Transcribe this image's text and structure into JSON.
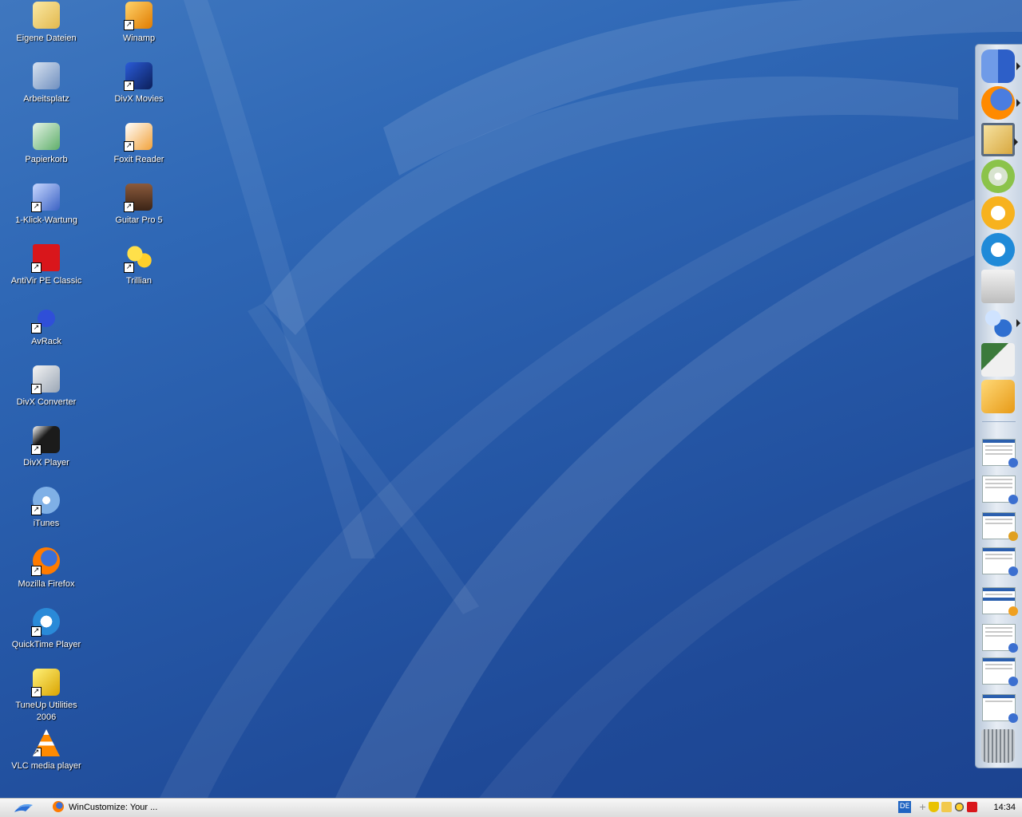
{
  "desktop_icons": {
    "eigene_dateien": "Eigene Dateien",
    "winamp": "Winamp",
    "arbeitsplatz": "Arbeitsplatz",
    "divx_movies": "DivX Movies",
    "papierkorb": "Papierkorb",
    "foxit_reader": "Foxit Reader",
    "klick_wartung": "1-Klick-Wartung",
    "guitar_pro": "Guitar Pro 5",
    "antivir": "AntiVir PE Classic",
    "trillian": "Trillian",
    "avrack": "AvRack",
    "divx_converter": "DivX Converter",
    "divx_player": "DivX Player",
    "itunes": "iTunes",
    "firefox": "Mozilla Firefox",
    "quicktime": "QuickTime Player",
    "tuneup": "TuneUp Utilities 2006",
    "vlc": "VLC media player"
  },
  "taskbar": {
    "task_label": "WinCustomize: Your ...",
    "language": "DE",
    "clock": "14:34"
  }
}
